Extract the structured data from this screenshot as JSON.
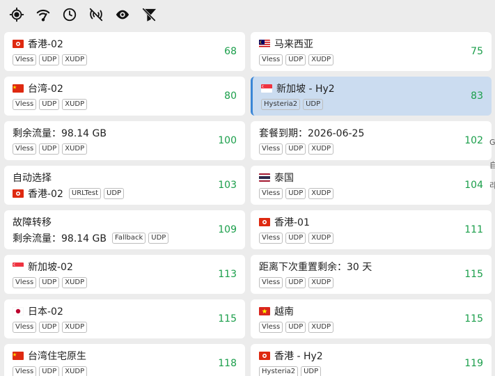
{
  "toolbar": {
    "icons": [
      "locate-icon",
      "wifi-speed-icon",
      "clock-icon",
      "no-signal-icon",
      "eye-icon",
      "filter-off-icon"
    ]
  },
  "colors": {
    "delay": "#1a9e4a",
    "selected_bg": "#cbdcf0",
    "selected_border": "#3a86d6"
  },
  "cards": [
    {
      "flag": "hk",
      "name": "香港-02",
      "tags": [
        "Vless",
        "UDP",
        "XUDP"
      ],
      "delay": "68"
    },
    {
      "flag": "my",
      "name": "马来西亚",
      "tags": [
        "Vless",
        "UDP",
        "XUDP"
      ],
      "delay": "75"
    },
    {
      "flag": "cn",
      "name": "台湾-02",
      "tags": [
        "Vless",
        "UDP",
        "XUDP"
      ],
      "delay": "80"
    },
    {
      "flag": "sg",
      "name": "新加坡 - Hy2",
      "tags": [
        "Hysteria2",
        "UDP"
      ],
      "delay": "83",
      "selected": true
    },
    {
      "flag": "",
      "name": "剩余流量：98.14 GB",
      "tags": [
        "Vless",
        "UDP",
        "XUDP"
      ],
      "delay": "100"
    },
    {
      "flag": "",
      "name": "套餐到期：2026-06-25",
      "tags": [
        "Vless",
        "UDP",
        "XUDP"
      ],
      "delay": "102"
    },
    {
      "flag": "",
      "name": "自动选择",
      "sub_flag": "hk",
      "sub_text": "香港-02",
      "tags": [
        "URLTest",
        "UDP"
      ],
      "delay": "103"
    },
    {
      "flag": "th",
      "name": "泰国",
      "tags": [
        "Vless",
        "UDP",
        "XUDP"
      ],
      "delay": "104"
    },
    {
      "flag": "",
      "name": "故障转移",
      "sub_flag": "",
      "sub_text": "剩余流量：98.14 GB",
      "tags": [
        "Fallback",
        "UDP"
      ],
      "delay": "109"
    },
    {
      "flag": "hk",
      "name": "香港-01",
      "tags": [
        "Vless",
        "UDP",
        "XUDP"
      ],
      "delay": "111"
    },
    {
      "flag": "sg",
      "name": "新加坡-02",
      "tags": [
        "Vless",
        "UDP",
        "XUDP"
      ],
      "delay": "113"
    },
    {
      "flag": "",
      "name": "距离下次重置剩余：30 天",
      "tags": [
        "Vless",
        "UDP",
        "XUDP"
      ],
      "delay": "115"
    },
    {
      "flag": "jp",
      "name": "日本-02",
      "tags": [
        "Vless",
        "UDP",
        "XUDP"
      ],
      "delay": "115"
    },
    {
      "flag": "vn",
      "name": "越南",
      "tags": [
        "Vless",
        "UDP",
        "XUDP"
      ],
      "delay": "115"
    },
    {
      "flag": "cn",
      "name": "台湾住宅原生",
      "tags": [
        "Vless",
        "UDP",
        "XUDP"
      ],
      "delay": "118"
    },
    {
      "flag": "hk",
      "name": "香港 - Hy2",
      "tags": [
        "Hysteria2",
        "UDP"
      ],
      "delay": "119"
    }
  ],
  "edge_fragments": [
    "G",
    "自",
    "라"
  ]
}
